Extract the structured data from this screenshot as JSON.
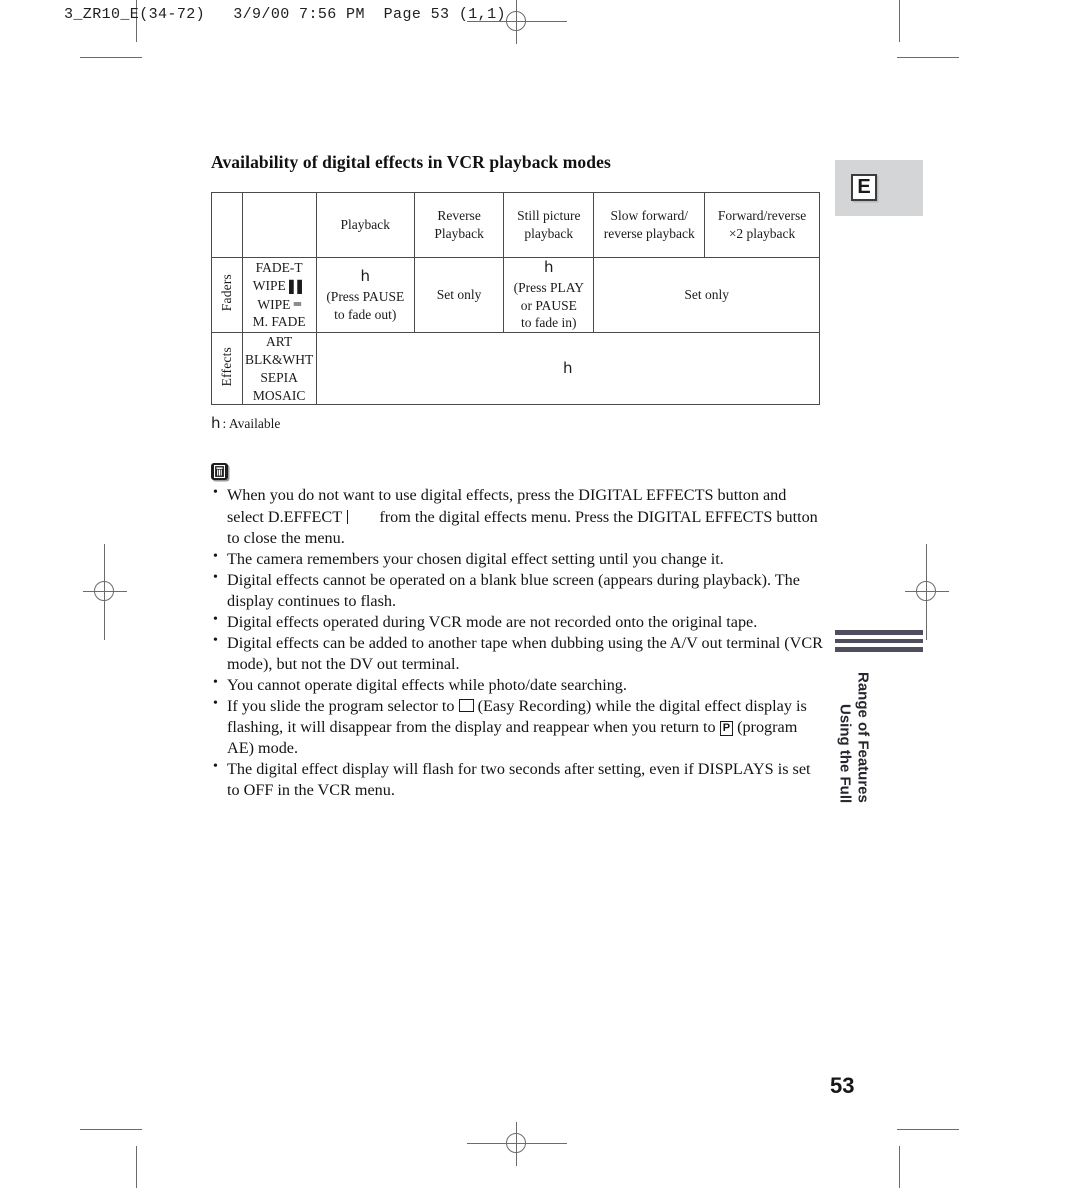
{
  "slug": "3_ZR10_E(34-72)   3/9/00 7:56 PM  Page 53 (1,1)",
  "section_title": "Availability of digital effects in VCR playback modes",
  "table": {
    "headers": [
      {
        "line1": "",
        "line2": ""
      },
      {
        "line1": "",
        "line2": ""
      },
      {
        "line1": "Playback",
        "line2": ""
      },
      {
        "line1": "Reverse",
        "line2": "Playback"
      },
      {
        "line1": "Still picture",
        "line2": "playback"
      },
      {
        "line1": "Slow forward/",
        "line2": "reverse playback"
      },
      {
        "line1": "Forward/reverse",
        "line2": "×2 playback"
      }
    ],
    "rows": [
      {
        "category": "Faders",
        "items": [
          "FADE-T",
          "WIPE",
          "WIPE",
          "M. FADE"
        ],
        "cells": {
          "playback": {
            "mark": "h",
            "lines": [
              "(Press PAUSE",
              "to fade out)"
            ]
          },
          "reverse": {
            "mark": "",
            "lines": [
              "Set only"
            ]
          },
          "still": {
            "mark": "h",
            "lines": [
              "(Press PLAY",
              "or PAUSE",
              "to fade in)"
            ]
          },
          "merged_slow_fwd": {
            "mark": "",
            "lines": [
              "Set only"
            ]
          }
        }
      },
      {
        "category": "Effects",
        "items": [
          "ART",
          "BLK&WHT",
          "SEPIA",
          "MOSAIC"
        ],
        "cells": {
          "merged_all": {
            "mark": "h",
            "lines": []
          }
        }
      }
    ],
    "legend": {
      "mark": "h",
      "text": ": Available"
    }
  },
  "notes": {
    "icon_name": "note-memo-icon",
    "items": [
      {
        "part1": "When you do not want to use digital effects, press the DIGITAL EFFECTS button and select D.EFFECT",
        "part2": "from the digital effects menu. Press the DIGITAL EFFECTS button to close the menu."
      },
      {
        "part1": "The camera remembers your chosen digital effect setting until you change it.",
        "part2": ""
      },
      {
        "part1": "Digital effects cannot be operated on a blank blue screen (appears during playback). The display continues to flash.",
        "part2": ""
      },
      {
        "part1": "Digital effects operated during VCR mode are not recorded onto the original tape.",
        "part2": ""
      },
      {
        "part1": "Digital effects can be added to another tape when dubbing using the A/V out terminal (VCR mode), but not the DV out terminal.",
        "part2": ""
      },
      {
        "part1": "You cannot operate digital effects while photo/date searching.",
        "part2": ""
      },
      {
        "part1": "If you slide the program selector to",
        "part2": "(Easy Recording) while the digital effect display is flashing, it will disappear from the display and reappear when you return to",
        "part3": "(program AE) mode.",
        "glyph_box_label": "P"
      },
      {
        "part1": "The digital effect display will flash for two seconds after setting, even if DISPLAYS is set to OFF in the VCR menu.",
        "part2": ""
      }
    ]
  },
  "side_tab": {
    "label": "E"
  },
  "side_title": {
    "line1": "Using the Full",
    "line2": "Range of Features"
  },
  "page_number": "53",
  "colors": {
    "tab_background": "#d3d5d6",
    "rail": "#4e4e5e",
    "rule": "#4a4a4a",
    "text": "#1a1a1a"
  }
}
